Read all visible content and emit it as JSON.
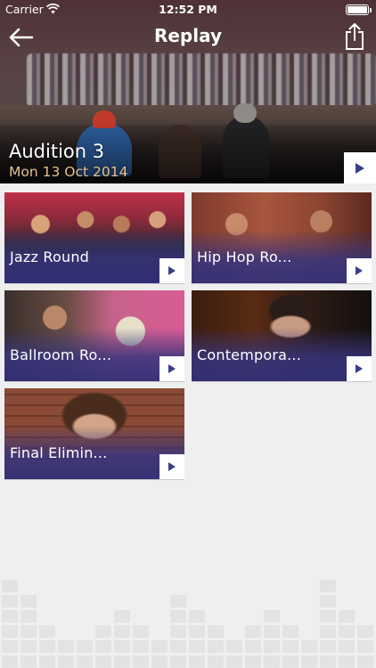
{
  "status_bar": {
    "carrier": "Carrier",
    "time": "12:52 PM"
  },
  "nav": {
    "title": "Replay",
    "back_icon": "back-arrow-icon",
    "share_icon": "share-icon"
  },
  "hero": {
    "title": "Audition 3",
    "date": "Mon 13 Oct 2014",
    "play_icon": "play-icon"
  },
  "episodes": [
    {
      "label": "Jazz Round"
    },
    {
      "label": "Hip Hop Ro..."
    },
    {
      "label": "Ballroom Ro..."
    },
    {
      "label": "Contempora..."
    },
    {
      "label": "Final Elimin..."
    }
  ],
  "colors": {
    "accent": "#3a3e84",
    "date": "#e8c28d",
    "background": "#efefef"
  }
}
